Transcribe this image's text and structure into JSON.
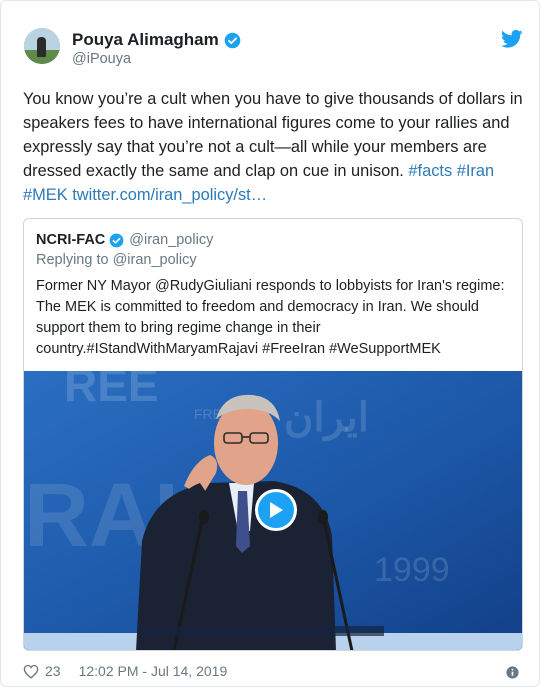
{
  "author": {
    "display_name": "Pouya Alimagham",
    "handle": "@iPouya",
    "avatar_icon": "profile-photo"
  },
  "tweet": {
    "text": "You know you’re a cult when you have to give thousands of dollars in speakers fees to have international figures come to your rallies and expressly say that you’re not a cult—all while your members are dressed exactly the same and clap on cue in unison.",
    "hashtag_1": "#facts",
    "hashtag_2": "#Iran",
    "hashtag_3": "#MEK",
    "link": "twitter.com/iran_policy/st…"
  },
  "quote": {
    "display_name": "NCRI-FAC",
    "handle": "@iran_policy",
    "replying_prefix": "Replying to",
    "replying_to": "@iran_policy",
    "text": "Former NY Mayor @RudyGiuliani responds to lobbyists for Iran's regime: The MEK is committed to freedom and democracy in Iran. We should support them to bring regime change in their country.#IStandWithMaryamRajavi #FreeIran #WeSupportMEK"
  },
  "footer": {
    "likes": "23",
    "timestamp": "12:02 PM - Jul 14, 2019"
  },
  "colors": {
    "link": "#2b7bb9",
    "twitter_blue": "#1da1f2",
    "secondary_text": "#697882"
  },
  "icons": [
    "verified-badge-icon",
    "twitter-bird-icon",
    "play-icon",
    "heart-icon",
    "info-icon"
  ]
}
